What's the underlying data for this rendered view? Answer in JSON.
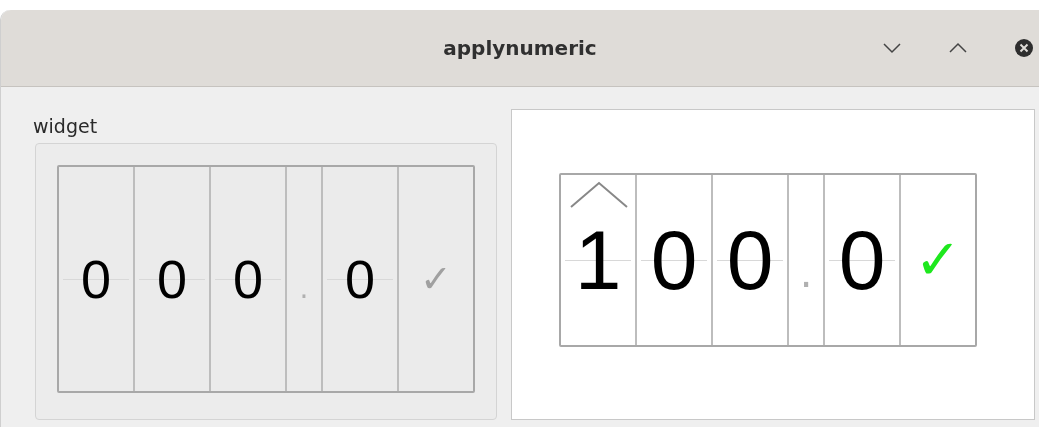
{
  "window": {
    "title": "applynumeric"
  },
  "group": {
    "label": "widget",
    "display": {
      "enabled": false,
      "cells": [
        {
          "kind": "digit",
          "text": "0",
          "hovered": false
        },
        {
          "kind": "digit",
          "text": "0",
          "hovered": false
        },
        {
          "kind": "digit",
          "text": "0",
          "hovered": false
        },
        {
          "kind": "separator",
          "text": "."
        },
        {
          "kind": "digit",
          "text": "0",
          "hovered": false
        },
        {
          "kind": "confirm",
          "text": "✓"
        }
      ]
    }
  },
  "preview": {
    "display": {
      "enabled": true,
      "cells": [
        {
          "kind": "digit",
          "text": "1",
          "hovered": true
        },
        {
          "kind": "digit",
          "text": "0",
          "hovered": false
        },
        {
          "kind": "digit",
          "text": "0",
          "hovered": false
        },
        {
          "kind": "separator",
          "text": "."
        },
        {
          "kind": "digit",
          "text": "0",
          "hovered": false
        },
        {
          "kind": "confirm",
          "text": "✓"
        }
      ]
    }
  }
}
